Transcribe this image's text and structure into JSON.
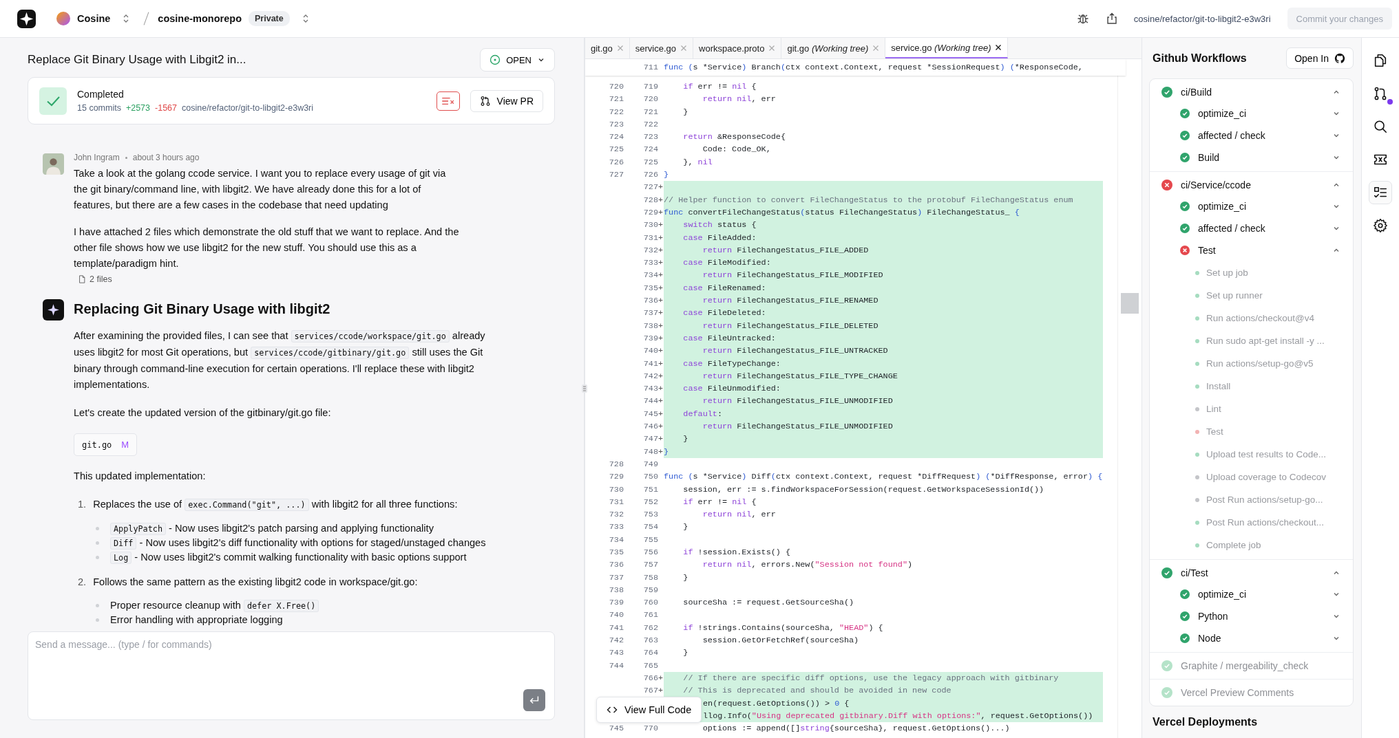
{
  "topbar": {
    "org": "Cosine",
    "repo": "cosine-monorepo",
    "visibility": "Private",
    "branch": "cosine/refactor/git-to-libgit2-e3w3ri",
    "commit_button": {
      "label": "Commit your changes",
      "disabled": true
    }
  },
  "task": {
    "title": "Replace Git Binary Usage with Libgit2 in...",
    "status_button": "OPEN",
    "status": "Completed",
    "commits": "15 commits",
    "additions": "+2573",
    "deletions": "-1567",
    "branch": "cosine/refactor/git-to-libgit2-e3w3ri",
    "view_pr": "View PR"
  },
  "user_message": {
    "author": "John Ingram",
    "time": "about 3 hours ago",
    "paragraphs": [
      "Take a look at the golang ccode service. I want you to replace every usage of git via the git binary/command line, with libgit2. We have already done this for a lot of features, but there are a few cases in the codebase that need updating",
      "I have attached 2 files which demonstrate the old stuff that we want to replace. And the other file shows how we use libgit2 for the new stuff. You should use this as a template/paradigm hint."
    ],
    "attachments": "2 files"
  },
  "assistant_message": {
    "title": "Replacing Git Binary Usage with libgit2",
    "blocks": [
      {
        "kind": "p",
        "segs": [
          {
            "t": "After examining the provided files, I can see that "
          },
          {
            "kind": "code",
            "t": "services/ccode/workspace/git.go"
          },
          {
            "t": " already uses libgit2 for most Git operations, but "
          },
          {
            "kind": "code",
            "t": "services/ccode/gitbinary/git.go"
          },
          {
            "t": " still uses the Git binary through command-line execution for certain operations. I'll replace these with libgit2 implementations."
          }
        ]
      },
      {
        "kind": "p",
        "segs": [
          {
            "t": "Let's create the updated version of the gitbinary/git.go file:"
          }
        ]
      },
      {
        "kind": "file",
        "name": "git.go",
        "badge": "M"
      },
      {
        "kind": "p",
        "segs": [
          {
            "t": "This updated implementation:"
          }
        ]
      },
      {
        "kind": "ol",
        "items": [
          {
            "marker": "1.",
            "segs": [
              {
                "t": "Replaces the use of "
              },
              {
                "kind": "code",
                "t": "exec.Command(\"git\", ...)"
              },
              {
                "t": " with libgit2 for all three functions:"
              }
            ],
            "bullets": [
              [
                {
                  "kind": "code",
                  "t": "ApplyPatch"
                },
                {
                  "t": " - Now uses libgit2's patch parsing and applying functionality"
                }
              ],
              [
                {
                  "kind": "code",
                  "t": "Diff"
                },
                {
                  "t": " - Now uses libgit2's diff functionality with options for staged/unstaged changes"
                }
              ],
              [
                {
                  "kind": "code",
                  "t": "Log"
                },
                {
                  "t": " - Now uses libgit2's commit walking functionality with basic options support"
                }
              ]
            ]
          },
          {
            "marker": "2.",
            "segs": [
              {
                "t": "Follows the same pattern as the existing libgit2 code in workspace/git.go:"
              }
            ],
            "bullets": [
              [
                {
                  "t": "Proper resource cleanup with "
                },
                {
                  "kind": "code",
                  "t": "defer X.Free()"
                }
              ],
              [
                {
                  "t": "Error handling with appropriate logging"
                }
              ]
            ]
          }
        ]
      }
    ]
  },
  "composer": {
    "placeholder": "Send a message... (type / for commands)"
  },
  "editor": {
    "tabs": [
      {
        "label": "git.go",
        "selected": false
      },
      {
        "label": "service.go",
        "selected": false
      },
      {
        "label": "workspace.proto",
        "selected": false
      },
      {
        "label": "git.go *(Working tree)*",
        "selected": false
      },
      {
        "label": "service.go *(Working tree)*",
        "selected": true
      }
    ],
    "sticky": {
      "n": "711",
      "s": [
        {
          "kind": "fn",
          "t": "func ("
        },
        {
          "t": "s *Service"
        },
        {
          "kind": "fn",
          "t": ")"
        },
        {
          "t": " Branch"
        },
        {
          "kind": "fn",
          "t": "("
        },
        {
          "t": "ctx context.Context, request *SessionRequest"
        },
        {
          "kind": "fn",
          "t": ") ("
        },
        {
          "t": "*ResponseCode,"
        }
      ]
    },
    "lines": [
      {
        "o": "720",
        "n": "719",
        "added": false,
        "s": [
          {
            "kind": "kw",
            "t": "    if"
          },
          {
            "t": " err != "
          },
          {
            "kind": "kw",
            "t": "nil"
          },
          {
            "t": " {"
          }
        ]
      },
      {
        "o": "721",
        "n": "720",
        "added": false,
        "s": [
          {
            "kind": "kw",
            "t": "        return nil"
          },
          {
            "t": ", err"
          }
        ]
      },
      {
        "o": "722",
        "n": "721",
        "added": false,
        "s": [
          {
            "t": "    }"
          }
        ]
      },
      {
        "o": "723",
        "n": "722",
        "added": false
      },
      {
        "o": "724",
        "n": "723",
        "added": false,
        "s": [
          {
            "kind": "kw",
            "t": "    return"
          },
          {
            "t": " &ResponseCode{"
          }
        ]
      },
      {
        "o": "725",
        "n": "724",
        "added": false,
        "s": [
          {
            "t": "        Code: Code_OK,"
          }
        ]
      },
      {
        "o": "726",
        "n": "725",
        "added": false,
        "s": [
          {
            "t": "    }, "
          },
          {
            "kind": "kw",
            "t": "nil"
          }
        ]
      },
      {
        "o": "727",
        "n": "726",
        "added": false,
        "s": [
          {
            "kind": "fn",
            "t": "}"
          }
        ]
      },
      {
        "n": "727",
        "sign": "+",
        "added": true
      },
      {
        "n": "728",
        "sign": "+",
        "added": true,
        "s": [
          {
            "kind": "cm",
            "t": "// Helper function to convert FileChangeStatus to the protobuf FileChangeStatus enum"
          }
        ]
      },
      {
        "n": "729",
        "sign": "+",
        "added": true,
        "s": [
          {
            "kind": "fn",
            "t": "func"
          },
          {
            "t": " convertFileChangeStatus"
          },
          {
            "kind": "fn",
            "t": "("
          },
          {
            "t": "status FileChangeStatus"
          },
          {
            "kind": "fn",
            "t": ")"
          },
          {
            "t": " FileChangeStatus_ "
          },
          {
            "kind": "fn",
            "t": "{"
          }
        ]
      },
      {
        "n": "730",
        "sign": "+",
        "added": true,
        "s": [
          {
            "kind": "kw",
            "t": "    switch"
          },
          {
            "t": " status {"
          }
        ]
      },
      {
        "n": "731",
        "sign": "+",
        "added": true,
        "s": [
          {
            "kind": "kw",
            "t": "    case"
          },
          {
            "t": " FileAdded:"
          }
        ]
      },
      {
        "n": "732",
        "sign": "+",
        "added": true,
        "s": [
          {
            "kind": "kw",
            "t": "        return"
          },
          {
            "t": " FileChangeStatus_FILE_ADDED"
          }
        ]
      },
      {
        "n": "733",
        "sign": "+",
        "added": true,
        "s": [
          {
            "kind": "kw",
            "t": "    case"
          },
          {
            "t": " FileModified:"
          }
        ]
      },
      {
        "n": "734",
        "sign": "+",
        "added": true,
        "s": [
          {
            "kind": "kw",
            "t": "        return"
          },
          {
            "t": " FileChangeStatus_FILE_MODIFIED"
          }
        ]
      },
      {
        "n": "735",
        "sign": "+",
        "added": true,
        "s": [
          {
            "kind": "kw",
            "t": "    case"
          },
          {
            "t": " FileRenamed:"
          }
        ]
      },
      {
        "n": "736",
        "sign": "+",
        "added": true,
        "s": [
          {
            "kind": "kw",
            "t": "        return"
          },
          {
            "t": " FileChangeStatus_FILE_RENAMED"
          }
        ]
      },
      {
        "n": "737",
        "sign": "+",
        "added": true,
        "s": [
          {
            "kind": "kw",
            "t": "    case"
          },
          {
            "t": " FileDeleted:"
          }
        ]
      },
      {
        "n": "738",
        "sign": "+",
        "added": true,
        "s": [
          {
            "kind": "kw",
            "t": "        return"
          },
          {
            "t": " FileChangeStatus_FILE_DELETED"
          }
        ]
      },
      {
        "n": "739",
        "sign": "+",
        "added": true,
        "s": [
          {
            "kind": "kw",
            "t": "    case"
          },
          {
            "t": " FileUntracked:"
          }
        ]
      },
      {
        "n": "740",
        "sign": "+",
        "added": true,
        "s": [
          {
            "kind": "kw",
            "t": "        return"
          },
          {
            "t": " FileChangeStatus_FILE_UNTRACKED"
          }
        ]
      },
      {
        "n": "741",
        "sign": "+",
        "added": true,
        "s": [
          {
            "kind": "kw",
            "t": "    case"
          },
          {
            "t": " FileTypeChange:"
          }
        ]
      },
      {
        "n": "742",
        "sign": "+",
        "added": true,
        "s": [
          {
            "kind": "kw",
            "t": "        return"
          },
          {
            "t": " FileChangeStatus_FILE_TYPE_CHANGE"
          }
        ]
      },
      {
        "n": "743",
        "sign": "+",
        "added": true,
        "s": [
          {
            "kind": "kw",
            "t": "    case"
          },
          {
            "t": " FileUnmodified:"
          }
        ]
      },
      {
        "n": "744",
        "sign": "+",
        "added": true,
        "s": [
          {
            "kind": "kw",
            "t": "        return"
          },
          {
            "t": " FileChangeStatus_FILE_UNMODIFIED"
          }
        ]
      },
      {
        "n": "745",
        "sign": "+",
        "added": true,
        "s": [
          {
            "kind": "kw",
            "t": "    default"
          },
          {
            "t": ":"
          }
        ]
      },
      {
        "n": "746",
        "sign": "+",
        "added": true,
        "s": [
          {
            "kind": "kw",
            "t": "        return"
          },
          {
            "t": " FileChangeStatus_FILE_UNMODIFIED"
          }
        ]
      },
      {
        "n": "747",
        "sign": "+",
        "added": true,
        "s": [
          {
            "t": "    }"
          }
        ]
      },
      {
        "n": "748",
        "sign": "+",
        "added": true,
        "s": [
          {
            "kind": "fn",
            "t": "}"
          }
        ]
      },
      {
        "o": "728",
        "n": "749",
        "added": false
      },
      {
        "o": "729",
        "n": "750",
        "added": false,
        "s": [
          {
            "kind": "fn",
            "t": "func ("
          },
          {
            "t": "s *Service"
          },
          {
            "kind": "fn",
            "t": ")"
          },
          {
            "t": " Diff"
          },
          {
            "kind": "fn",
            "t": "("
          },
          {
            "t": "ctx context.Context, request *DiffRequest"
          },
          {
            "kind": "fn",
            "t": ") ("
          },
          {
            "t": "*DiffResponse, error"
          },
          {
            "kind": "fn",
            "t": ") {"
          }
        ]
      },
      {
        "o": "730",
        "n": "751",
        "added": false,
        "s": [
          {
            "t": "    session, err := s.findWorkspaceForSession(request.GetWorkspaceSessionId())"
          }
        ]
      },
      {
        "o": "731",
        "n": "752",
        "added": false,
        "s": [
          {
            "kind": "kw",
            "t": "    if"
          },
          {
            "t": " err != "
          },
          {
            "kind": "kw",
            "t": "nil"
          },
          {
            "t": " {"
          }
        ]
      },
      {
        "o": "732",
        "n": "753",
        "added": false,
        "s": [
          {
            "kind": "kw",
            "t": "        return nil"
          },
          {
            "t": ", err"
          }
        ]
      },
      {
        "o": "733",
        "n": "754",
        "added": false,
        "s": [
          {
            "t": "    }"
          }
        ]
      },
      {
        "o": "734",
        "n": "755",
        "added": false
      },
      {
        "o": "735",
        "n": "756",
        "added": false,
        "s": [
          {
            "kind": "kw",
            "t": "    if"
          },
          {
            "t": " !session.Exists() {"
          }
        ]
      },
      {
        "o": "736",
        "n": "757",
        "added": false,
        "s": [
          {
            "kind": "kw",
            "t": "        return nil"
          },
          {
            "t": ", errors.New("
          },
          {
            "kind": "str",
            "t": "\"Session not found\""
          },
          {
            "t": ")"
          }
        ]
      },
      {
        "o": "737",
        "n": "758",
        "added": false,
        "s": [
          {
            "t": "    }"
          }
        ]
      },
      {
        "o": "738",
        "n": "759",
        "added": false
      },
      {
        "o": "739",
        "n": "760",
        "added": false,
        "s": [
          {
            "t": "    sourceSha := request.GetSourceSha()"
          }
        ]
      },
      {
        "o": "740",
        "n": "761",
        "added": false
      },
      {
        "o": "741",
        "n": "762",
        "added": false,
        "s": [
          {
            "kind": "kw",
            "t": "    if"
          },
          {
            "t": " !strings.Contains(sourceSha, "
          },
          {
            "kind": "str",
            "t": "\"HEAD\""
          },
          {
            "t": ") {"
          }
        ]
      },
      {
        "o": "742",
        "n": "763",
        "added": false,
        "s": [
          {
            "t": "        session.GetOrFetchRef(sourceSha)"
          }
        ]
      },
      {
        "o": "743",
        "n": "764",
        "added": false,
        "s": [
          {
            "t": "    }"
          }
        ]
      },
      {
        "o": "744",
        "n": "765",
        "added": false
      },
      {
        "n": "766",
        "sign": "+",
        "added": true,
        "s": [
          {
            "kind": "cm",
            "t": "    // If there are specific diff options, use the legacy approach with gitbinary"
          }
        ]
      },
      {
        "n": "767",
        "sign": "+",
        "added": true,
        "s": [
          {
            "kind": "cm",
            "t": "    // This is deprecated and should be avoided in new code"
          }
        ]
      },
      {
        "added": true,
        "covered": true,
        "s": [
          {
            "t": "en(request.GetOptions()) > "
          },
          {
            "kind": "num",
            "t": "0"
          },
          {
            "t": " {"
          }
        ]
      },
      {
        "added": true,
        "covered": true,
        "s": [
          {
            "t": "llog.Info("
          },
          {
            "kind": "str",
            "t": "\"Using deprecated gitbinary.Diff with options:\""
          },
          {
            "t": ", request.GetOptions())"
          }
        ]
      },
      {
        "o": "745",
        "n": "770",
        "added": false,
        "s": [
          {
            "t": "        options := append([]"
          },
          {
            "kind": "kw",
            "t": "string"
          },
          {
            "t": "{sourceSha}, request.GetOptions()...)"
          }
        ]
      }
    ],
    "view_full_code": "View Full Code"
  },
  "workflows": {
    "title": "Github Workflows",
    "open_in": "Open In",
    "groups": [
      {
        "name": "ci/Build",
        "kind": "success",
        "expanded": true,
        "jobs": [
          {
            "name": "optimize_ci",
            "kind": "success",
            "expanded": false
          },
          {
            "name": "affected / check",
            "kind": "success",
            "expanded": false
          },
          {
            "name": "Build",
            "kind": "success",
            "expanded": false
          }
        ]
      },
      {
        "name": "ci/Service/ccode",
        "kind": "failure",
        "expanded": true,
        "jobs": [
          {
            "name": "optimize_ci",
            "kind": "success",
            "expanded": false
          },
          {
            "name": "affected / check",
            "kind": "success",
            "expanded": false
          },
          {
            "name": "Test",
            "kind": "failure",
            "expanded": true,
            "steps": [
              {
                "name": "Set up job",
                "color": "#a6dcc0"
              },
              {
                "name": "Set up runner",
                "color": "#a6dcc0"
              },
              {
                "name": "Run actions/checkout@v4",
                "color": "#a6dcc0"
              },
              {
                "name": "Run sudo apt-get install -y ...",
                "color": "#a6dcc0"
              },
              {
                "name": "Run actions/setup-go@v5",
                "color": "#a6dcc0"
              },
              {
                "name": "Install",
                "color": "#a6dcc0"
              },
              {
                "name": "Lint",
                "color": "#c4c5c9"
              },
              {
                "name": "Test",
                "color": "#f2b3b3"
              },
              {
                "name": "Upload test results to Code...",
                "color": "#a6dcc0"
              },
              {
                "name": "Upload coverage to Codecov",
                "color": "#c4c5c9"
              },
              {
                "name": "Post Run actions/setup-go...",
                "color": "#c4c5c9"
              },
              {
                "name": "Post Run actions/checkout...",
                "color": "#a6dcc0"
              },
              {
                "name": "Complete job",
                "color": "#a6dcc0"
              }
            ]
          }
        ]
      },
      {
        "name": "ci/Test",
        "kind": "success",
        "expanded": true,
        "jobs": [
          {
            "name": "optimize_ci",
            "kind": "success",
            "expanded": false
          },
          {
            "name": "Python",
            "kind": "success",
            "expanded": false
          },
          {
            "name": "Node",
            "kind": "success",
            "expanded": false
          }
        ]
      },
      {
        "name": "Graphite / mergeability_check",
        "kind": "muted"
      },
      {
        "name": "Vercel Preview Comments",
        "kind": "muted"
      }
    ],
    "next_section": "Vercel Deployments"
  },
  "rail": [
    {
      "kind": "files",
      "selected": false
    },
    {
      "kind": "pull-request",
      "selected": false,
      "badge": true
    },
    {
      "kind": "search",
      "selected": false
    },
    {
      "kind": "ticket",
      "selected": false
    },
    {
      "kind": "checklist",
      "selected": true
    },
    {
      "kind": "settings",
      "selected": false
    }
  ]
}
